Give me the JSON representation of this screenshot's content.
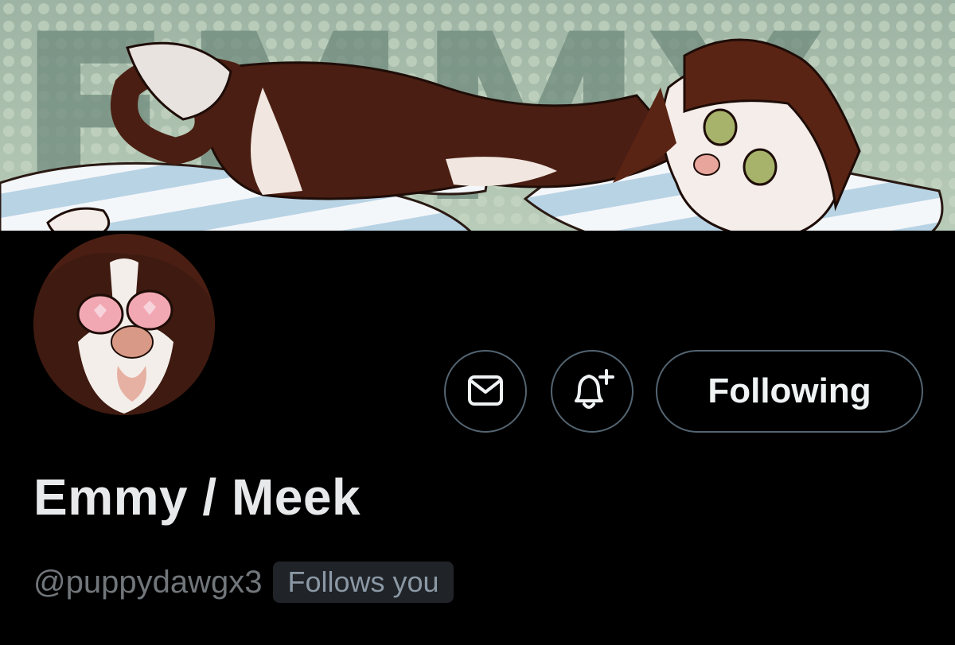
{
  "profile": {
    "banner_text": "EMMY",
    "display_name": "Emmy / Meek",
    "handle": "@puppydawgx3",
    "follows_you_badge": "Follows you"
  },
  "actions": {
    "message_icon": "envelope-icon",
    "notify_icon": "bell-plus-icon",
    "following_label": "Following"
  },
  "colors": {
    "background": "#000000",
    "button_border": "#536471",
    "name_text": "#e7e9ea",
    "handle_text": "#71767b",
    "badge_bg": "#202327",
    "banner_bg": "#b7cbb9",
    "fur_brown": "#4a1e12",
    "stripe_blue": "#b8d3e4"
  }
}
